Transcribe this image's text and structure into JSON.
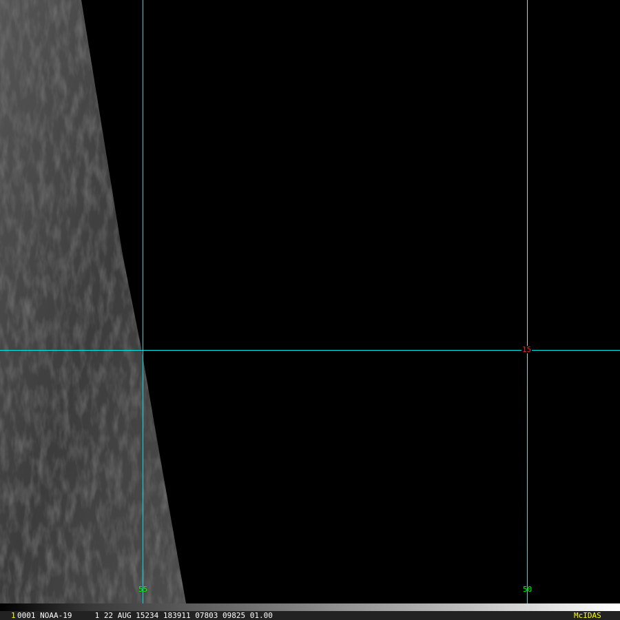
{
  "grid": {
    "lat_label": "15",
    "lon_labels": [
      "55",
      "50"
    ],
    "colors": {
      "primary_line": "#00e5e5",
      "secondary_line": "#c8c8c8",
      "lat_label": "#ff2020",
      "lon_label": "#00ff00"
    }
  },
  "info_bar": {
    "frame_number": "1",
    "text": "0001 NOAA-19     1 22 AUG 15234 183911 07803 09825 01.00",
    "brand": "McIDAS"
  }
}
